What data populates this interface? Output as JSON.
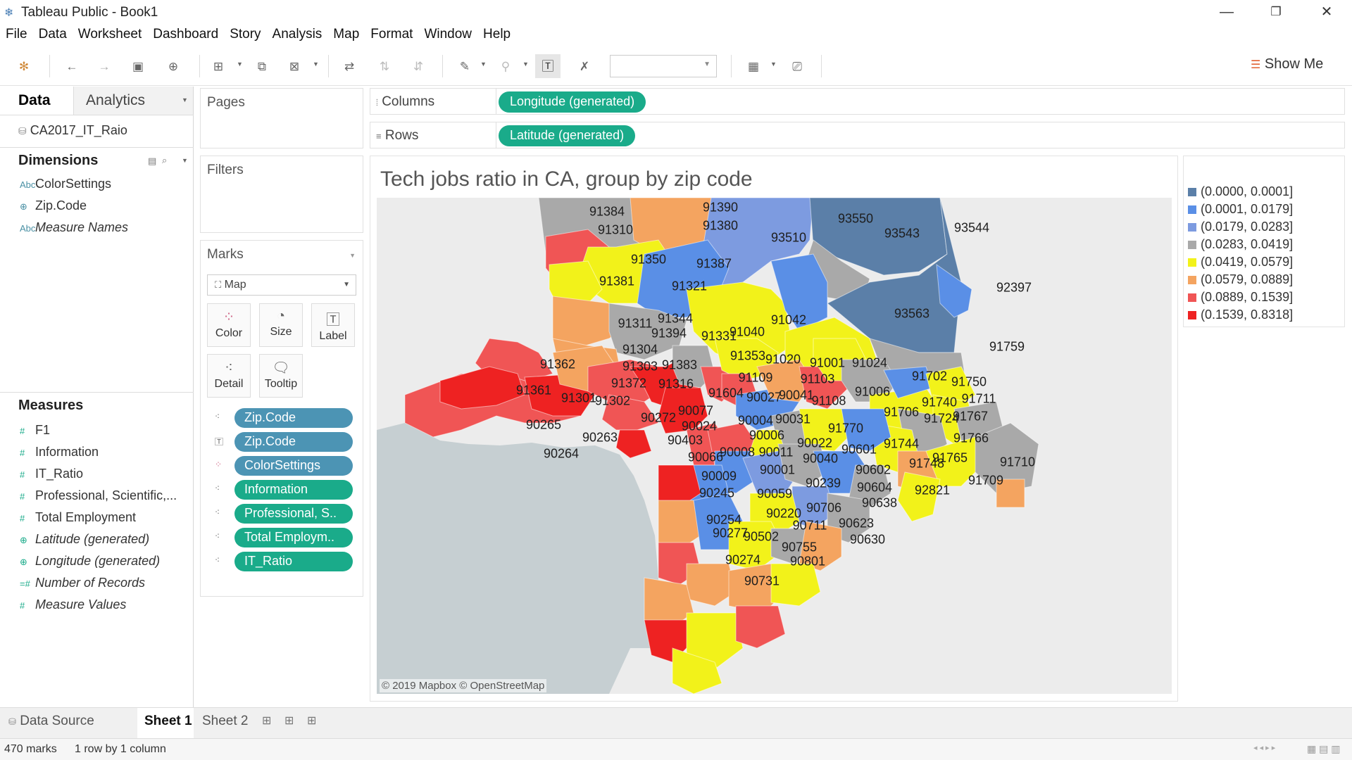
{
  "window": {
    "title": "Tableau Public - Book1"
  },
  "menu": [
    "File",
    "Data",
    "Worksheet",
    "Dashboard",
    "Story",
    "Analysis",
    "Map",
    "Format",
    "Window",
    "Help"
  ],
  "toolbar": {
    "show_me": "Show Me"
  },
  "data_pane": {
    "tab_data": "Data",
    "tab_analytics": "Analytics",
    "datasource": "CA2017_IT_Raio",
    "dimensions_title": "Dimensions",
    "dimensions": [
      {
        "name": "ColorSettings",
        "icon": "Abc"
      },
      {
        "name": "Zip.Code",
        "icon": "globe"
      },
      {
        "name": "Measure Names",
        "icon": "Abc"
      }
    ],
    "measures_title": "Measures",
    "measures": [
      {
        "name": "F1",
        "icon": "#"
      },
      {
        "name": "Information",
        "icon": "#"
      },
      {
        "name": "IT_Ratio",
        "icon": "#"
      },
      {
        "name": "Professional, Scientific,...",
        "icon": "#"
      },
      {
        "name": "Total Employment",
        "icon": "#"
      },
      {
        "name": "Latitude (generated)",
        "icon": "globe"
      },
      {
        "name": "Longitude (generated)",
        "icon": "globe"
      },
      {
        "name": "Number of Records",
        "icon": "=#"
      },
      {
        "name": "Measure Values",
        "icon": "#"
      }
    ]
  },
  "cards": {
    "pages": "Pages",
    "filters": "Filters",
    "marks": "Marks",
    "mark_type": "Map",
    "mark_buttons": {
      "color": "Color",
      "size": "Size",
      "label": "Label",
      "detail": "Detail",
      "tooltip": "Tooltip"
    },
    "mark_pills": [
      {
        "label": "Zip.Code",
        "kind": "dim"
      },
      {
        "label": "Zip.Code",
        "kind": "dim"
      },
      {
        "label": "ColorSettings",
        "kind": "dim"
      },
      {
        "label": "Information",
        "kind": "mea"
      },
      {
        "label": "Professional, S..",
        "kind": "mea"
      },
      {
        "label": "Total Employm..",
        "kind": "mea"
      },
      {
        "label": "IT_Ratio",
        "kind": "mea"
      }
    ]
  },
  "shelves": {
    "columns_label": "Columns",
    "columns_pill": "Longitude (generated)",
    "rows_label": "Rows",
    "rows_pill": "Latitude (generated)"
  },
  "view": {
    "title": "Tech jobs ratio in CA, group by zip code",
    "credit": "© 2019 Mapbox © OpenStreetMap"
  },
  "legend": [
    {
      "label": "(0.0000, 0.0001]",
      "color": "#5b7fa8"
    },
    {
      "label": "(0.0001, 0.0179]",
      "color": "#5a8fe6"
    },
    {
      "label": "(0.0179, 0.0283]",
      "color": "#7d9be0"
    },
    {
      "label": "(0.0283, 0.0419]",
      "color": "#a9a9a9"
    },
    {
      "label": "(0.0419, 0.0579]",
      "color": "#f2f21a"
    },
    {
      "label": "(0.0579, 0.0889]",
      "color": "#f4a460"
    },
    {
      "label": "(0.0889, 0.1539]",
      "color": "#f05555"
    },
    {
      "label": "(0.1539, 0.8318]",
      "color": "#ee2222"
    }
  ],
  "zip_labels": [
    "91384",
    "91390",
    "91310",
    "91380",
    "93550",
    "93510",
    "93543",
    "93544",
    "91350",
    "91387",
    "91381",
    "91321",
    "92397",
    "91344",
    "91311",
    "93563",
    "91394",
    "91042",
    "91331",
    "91040",
    "91304",
    "91759",
    "91362",
    "91303",
    "91383",
    "91353",
    "91020",
    "91001",
    "91024",
    "91372",
    "91316",
    "91109",
    "91103",
    "91702",
    "91750",
    "91361",
    "91301",
    "91302",
    "91604",
    "90027",
    "90041",
    "91108",
    "91006",
    "91740",
    "91711",
    "90265",
    "90077",
    "91706",
    "91724",
    "91767",
    "90272",
    "90024",
    "90004",
    "90031",
    "91770",
    "90263",
    "90403",
    "90006",
    "90022",
    "91744",
    "91766",
    "90264",
    "90066",
    "90008",
    "90011",
    "90040",
    "90601",
    "91748",
    "91765",
    "91710",
    "90001",
    "90602",
    "90009",
    "90239",
    "90604",
    "91709",
    "90245",
    "90059",
    "92821",
    "90638",
    "90706",
    "90220",
    "90254",
    "90711",
    "90623",
    "90277",
    "90502",
    "90630",
    "90755",
    "90274",
    "90801",
    "90731"
  ],
  "sheets": {
    "data_source": "Data Source",
    "sheet1": "Sheet 1",
    "sheet2": "Sheet 2"
  },
  "status": {
    "marks": "470 marks",
    "rows": "1 row by 1 column"
  }
}
